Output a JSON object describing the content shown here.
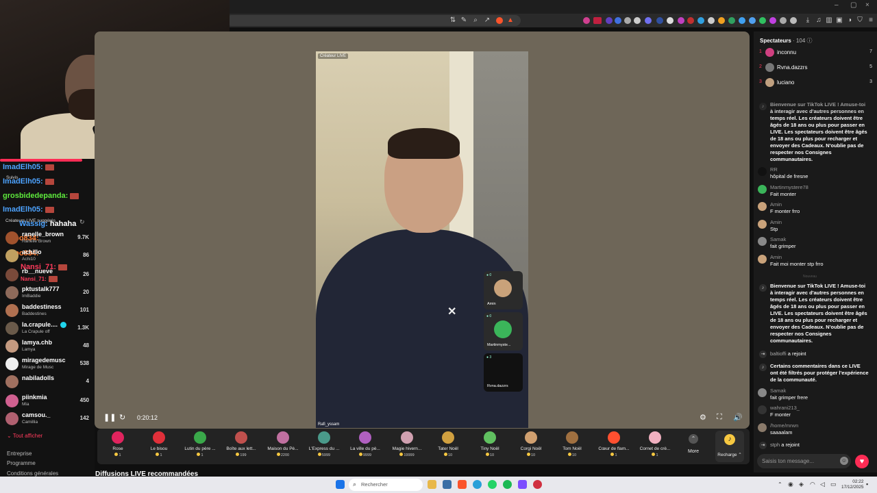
{
  "browser": {
    "window_controls": [
      "–",
      "▢",
      "×"
    ]
  },
  "left_sidebar": {
    "chat_overlay": [
      {
        "user": "ImadElh05:",
        "color": "#4da3ff"
      },
      {
        "user": "ImadElh05:",
        "color": "#4da3ff"
      },
      {
        "user": "grosbidedepanda:",
        "color": "#5eea3c"
      },
      {
        "user": "ImadElh05:",
        "color": "#4da3ff"
      },
      {
        "user": "Wassig:",
        "text": "hahaha",
        "color": "#4da3ff"
      },
      {
        "user": "apo834:",
        "color": "#ff7a2e"
      },
      {
        "user": "apo834:",
        "color": "#ff7a2e"
      },
      {
        "user": "Nansi_71:",
        "color": "#ff3b5c"
      },
      {
        "user": "Nansi_71:",
        "color": "#ff3b5c"
      }
    ],
    "followed_label": "Suivis",
    "section_label": "Créateurs LIVE suggérés",
    "creators": [
      {
        "name": "ranelle_brown",
        "sub": "Ranelle Brown",
        "count": "9.7K",
        "color": "#a0522d"
      },
      {
        "name": "achillo",
        "sub": "Achi10",
        "count": "86",
        "color": "#c0a060"
      },
      {
        "name": "rb__nueve",
        "sub": "",
        "count": "26",
        "color": "#7a4a3a"
      },
      {
        "name": "pktustalk777",
        "sub": "ImBaddie",
        "count": "20",
        "color": "#8e6a5a"
      },
      {
        "name": "baddestiness",
        "sub": "Baddestines",
        "count": "101",
        "color": "#b07050"
      },
      {
        "name": "la.crapule....",
        "sub": "La Crapule off",
        "count": "1.3K",
        "color": "#6a5a4a"
      },
      {
        "name": "lamya.chb",
        "sub": "Lamya",
        "count": "48",
        "color": "#c49a80"
      },
      {
        "name": "miragedemusc",
        "sub": "Mirage de Musc",
        "count": "538",
        "color": "#eeeeee"
      },
      {
        "name": "nabiladolls",
        "sub": "",
        "count": "4",
        "color": "#a07060"
      },
      {
        "name": "piinkmia",
        "sub": "Mia",
        "count": "450",
        "color": "#d06090"
      },
      {
        "name": "camsou._",
        "sub": "Camillia",
        "count": "142",
        "color": "#b06070"
      }
    ],
    "show_all": "Tout afficher",
    "footer_links": [
      "Entreprise",
      "Programme",
      "Conditions générales"
    ]
  },
  "stage": {
    "live_tag": "Créateur LIVE",
    "host_name": "Rafi_yssam",
    "timer": "0:20:12",
    "guests": [
      {
        "name": "Amin",
        "count": "0",
        "color": "#c9a27a"
      },
      {
        "name": "Martinmyste...",
        "count": "0",
        "color": "#3bb55a"
      },
      {
        "name": "Rvna.dazzrs",
        "count": "3",
        "color": "#111111"
      }
    ]
  },
  "gifts": [
    {
      "label": "Rose",
      "price": "1",
      "color": "#e0245e"
    },
    {
      "label": "Le bisou",
      "price": "1",
      "color": "#e0303a"
    },
    {
      "label": "Lutin du père ...",
      "price": "1",
      "color": "#3aa84a"
    },
    {
      "label": "Boîte aux lett...",
      "price": "199",
      "color": "#c0504d"
    },
    {
      "label": "Maison du Pè...",
      "price": "2200",
      "color": "#c070a0"
    },
    {
      "label": "L'Express du ...",
      "price": "5999",
      "color": "#4a9a8a"
    },
    {
      "label": "La ville du pè...",
      "price": "9999",
      "color": "#b060c0"
    },
    {
      "label": "Magie hivern...",
      "price": "19999",
      "color": "#d0a0b0"
    },
    {
      "label": "Tater Noël",
      "price": "10",
      "color": "#d0a040"
    },
    {
      "label": "Tiny Noël",
      "price": "10",
      "color": "#60c060"
    },
    {
      "label": "Corgi Noël",
      "price": "10",
      "color": "#d0a070"
    },
    {
      "label": "Tom Noël",
      "price": "10",
      "color": "#a07040"
    },
    {
      "label": "Cœur de flam...",
      "price": "1",
      "color": "#ff5030"
    },
    {
      "label": "Cornet de crè...",
      "price": "1",
      "color": "#f0b0c0"
    }
  ],
  "more_label": "More",
  "recharge_label": "Recharge",
  "recommended_title": "Diffusions LIVE recommandées",
  "right_panel": {
    "viewers_label": "Spectateurs",
    "viewers_count": "104",
    "top_viewers": [
      {
        "rank": "1",
        "name": "inconnu",
        "score": "7",
        "color": "#d04080"
      },
      {
        "rank": "2",
        "name": "Rvna.dazzrs",
        "score": "5",
        "color": "#777777"
      },
      {
        "rank": "3",
        "name": "luciano",
        "score": "3",
        "color": "#c0a080"
      }
    ],
    "welcome_message": "Bienvenue sur TikTok LIVE ! Amuse-toi à interagir avec d'autres personnes en temps réel. Les créateurs doivent être âgés de 18 ans ou plus pour passer en LIVE. Les spectateurs doivent être âgés de 18 ans ou plus pour recharger et envoyer des Cadeaux. N'oublie pas de respecter nos Consignes communautaires.",
    "messages": [
      {
        "user": "RR",
        "text": "hôpital de fresne",
        "color": "#111111"
      },
      {
        "user": "Martinmystere78",
        "text": "Fait monter",
        "color": "#3bb55a"
      },
      {
        "user": "Amin",
        "text": "F monter frro",
        "color": "#c9a27a"
      },
      {
        "user": "Amin",
        "text": "Stp",
        "color": "#c9a27a"
      },
      {
        "user": "Samak",
        "text": "fait grimper",
        "color": "#888888"
      },
      {
        "user": "Amin",
        "text": "Fait moi monter stp frro",
        "color": "#c9a27a"
      }
    ],
    "divider_text": "Nouveau",
    "welcome_message_2": "Bienvenue sur TikTok LIVE ! Amuse-toi à interagir avec d'autres personnes en temps réel. Les créateurs doivent être âgés de 18 ans ou plus pour passer en LIVE. Les spectateurs doivent être âgés de 18 ans ou plus pour recharger et envoyer des Cadeaux. N'oublie pas de respecter nos Consignes communautaires.",
    "join_1": {
      "user": "baltioffi",
      "text": "a rejoint"
    },
    "filter_notice": "Certains commentaires dans ce LIVE ont été filtrés pour protéger l'expérience de la communauté.",
    "messages_2": [
      {
        "user": "Samak",
        "text": "fait grimper frere",
        "color": "#888888"
      },
      {
        "user": "wahrani213_",
        "text": "F monter",
        "color": "#333333"
      },
      {
        "user": "/home/mrwn",
        "text": "saaaalam",
        "color": "#8a7a6a"
      }
    ],
    "join_2": {
      "user": "stph",
      "text": "a rejoint"
    },
    "input_placeholder": "Saisis ton message..."
  },
  "taskbar": {
    "search_label": "Rechercher",
    "time": "02:22",
    "date": "17/12/2025"
  }
}
